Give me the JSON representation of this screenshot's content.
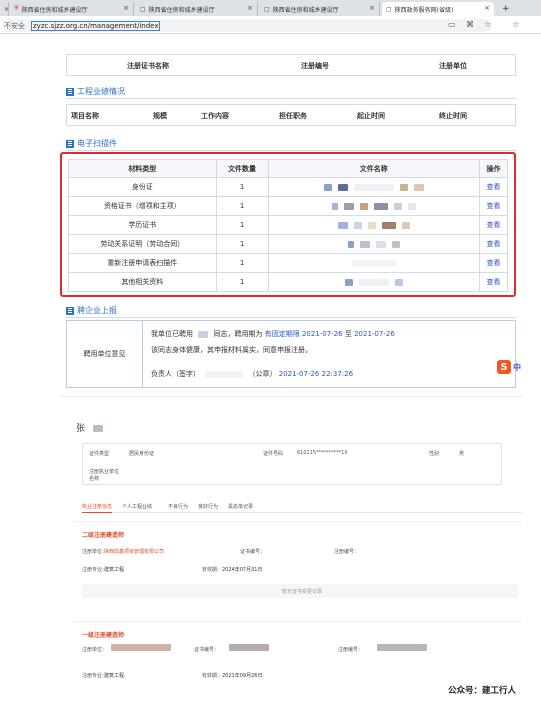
{
  "browser": {
    "tabs": [
      {
        "label": "陕西省住房和城乡建设厅"
      },
      {
        "label": "陕西省住房和城乡建设厅"
      },
      {
        "label": "陕西省住房和城乡建设厅"
      },
      {
        "label": "陕西政务服务网(省级)"
      }
    ],
    "security": "不安全",
    "url": "zyzc.sjzz.org.cn/management/index"
  },
  "reg_table": {
    "headers": [
      "注册证书名称",
      "注册编号",
      "注册单位"
    ]
  },
  "perf_section": {
    "title": "工程业绩情况",
    "headers": [
      "项目名称",
      "规模",
      "工作内容",
      "担任职务",
      "起止时间",
      "终止时间"
    ]
  },
  "scan_section": {
    "title": "电子扫描件",
    "headers": [
      "材料类型",
      "文件数量",
      "文件名称",
      "操作"
    ],
    "rows": [
      {
        "type": "身份证",
        "count": "1",
        "action": "查看"
      },
      {
        "type": "资格证书（增项和主项）",
        "count": "1",
        "action": "查看"
      },
      {
        "type": "学历证书",
        "count": "1",
        "action": "查看"
      },
      {
        "type": "劳动关系证明（劳动合同）",
        "count": "1",
        "action": "查看"
      },
      {
        "type": "重新注册申请表扫描件",
        "count": "1",
        "action": "查看"
      },
      {
        "type": "其他相关资料",
        "count": "1",
        "action": "查看"
      }
    ]
  },
  "recruit_section": {
    "title": "聘企业上报",
    "label": "聘用单位意见",
    "line1_a": "我单位已聘用",
    "line1_b": "同志，聘用期为",
    "line1_period": "有固定期限",
    "line1_start": "2021-07-26",
    "line1_to": "至",
    "line1_end": "2021-07-26",
    "line2": "该同志身体健康，其申报材料属实，同意申报注册。",
    "line3_a": "负责人（签字）",
    "line3_seal": "（公章）",
    "line3_time": "2021-07-26 22:37:26"
  },
  "sogou": {
    "icon": "S",
    "text": "中"
  },
  "profile": {
    "name_char": "张",
    "id_type_label": "证件类型",
    "id_type_value": "居民身份证",
    "id_no_label": "证件号码",
    "id_no_value": "610115**********1X",
    "gender_label": "性别",
    "gender_value": "男",
    "company_label": "注册执业单位名称",
    "tabs": [
      "执业注册信息",
      "个人工程业绩",
      "不良行为",
      "良好行为",
      "黑名单记录"
    ],
    "cert2": {
      "title": "二级注册建造师",
      "unit_label": "注册单位：",
      "unit_value": "陕西鼎鑫项目管理有限公司",
      "cert_no_label": "证书编号：",
      "reg_no_label": "注册编号：",
      "major_label": "注册专业：",
      "major_value": "建筑工程",
      "valid_label": "有效期：",
      "valid_value": "2024年07月31日",
      "empty_note": "暂无证书变更记录"
    },
    "cert1": {
      "title": "一级注册建造师",
      "unit_label": "注册单位：",
      "cert_no_label": "证书编号：",
      "reg_no_label": "注册编号：",
      "major_label": "注册专业：",
      "major_value": "建筑工程",
      "valid_label": "有效期：",
      "valid_value": "2021年09月26日"
    }
  },
  "watermark": "公众号：建工行人"
}
